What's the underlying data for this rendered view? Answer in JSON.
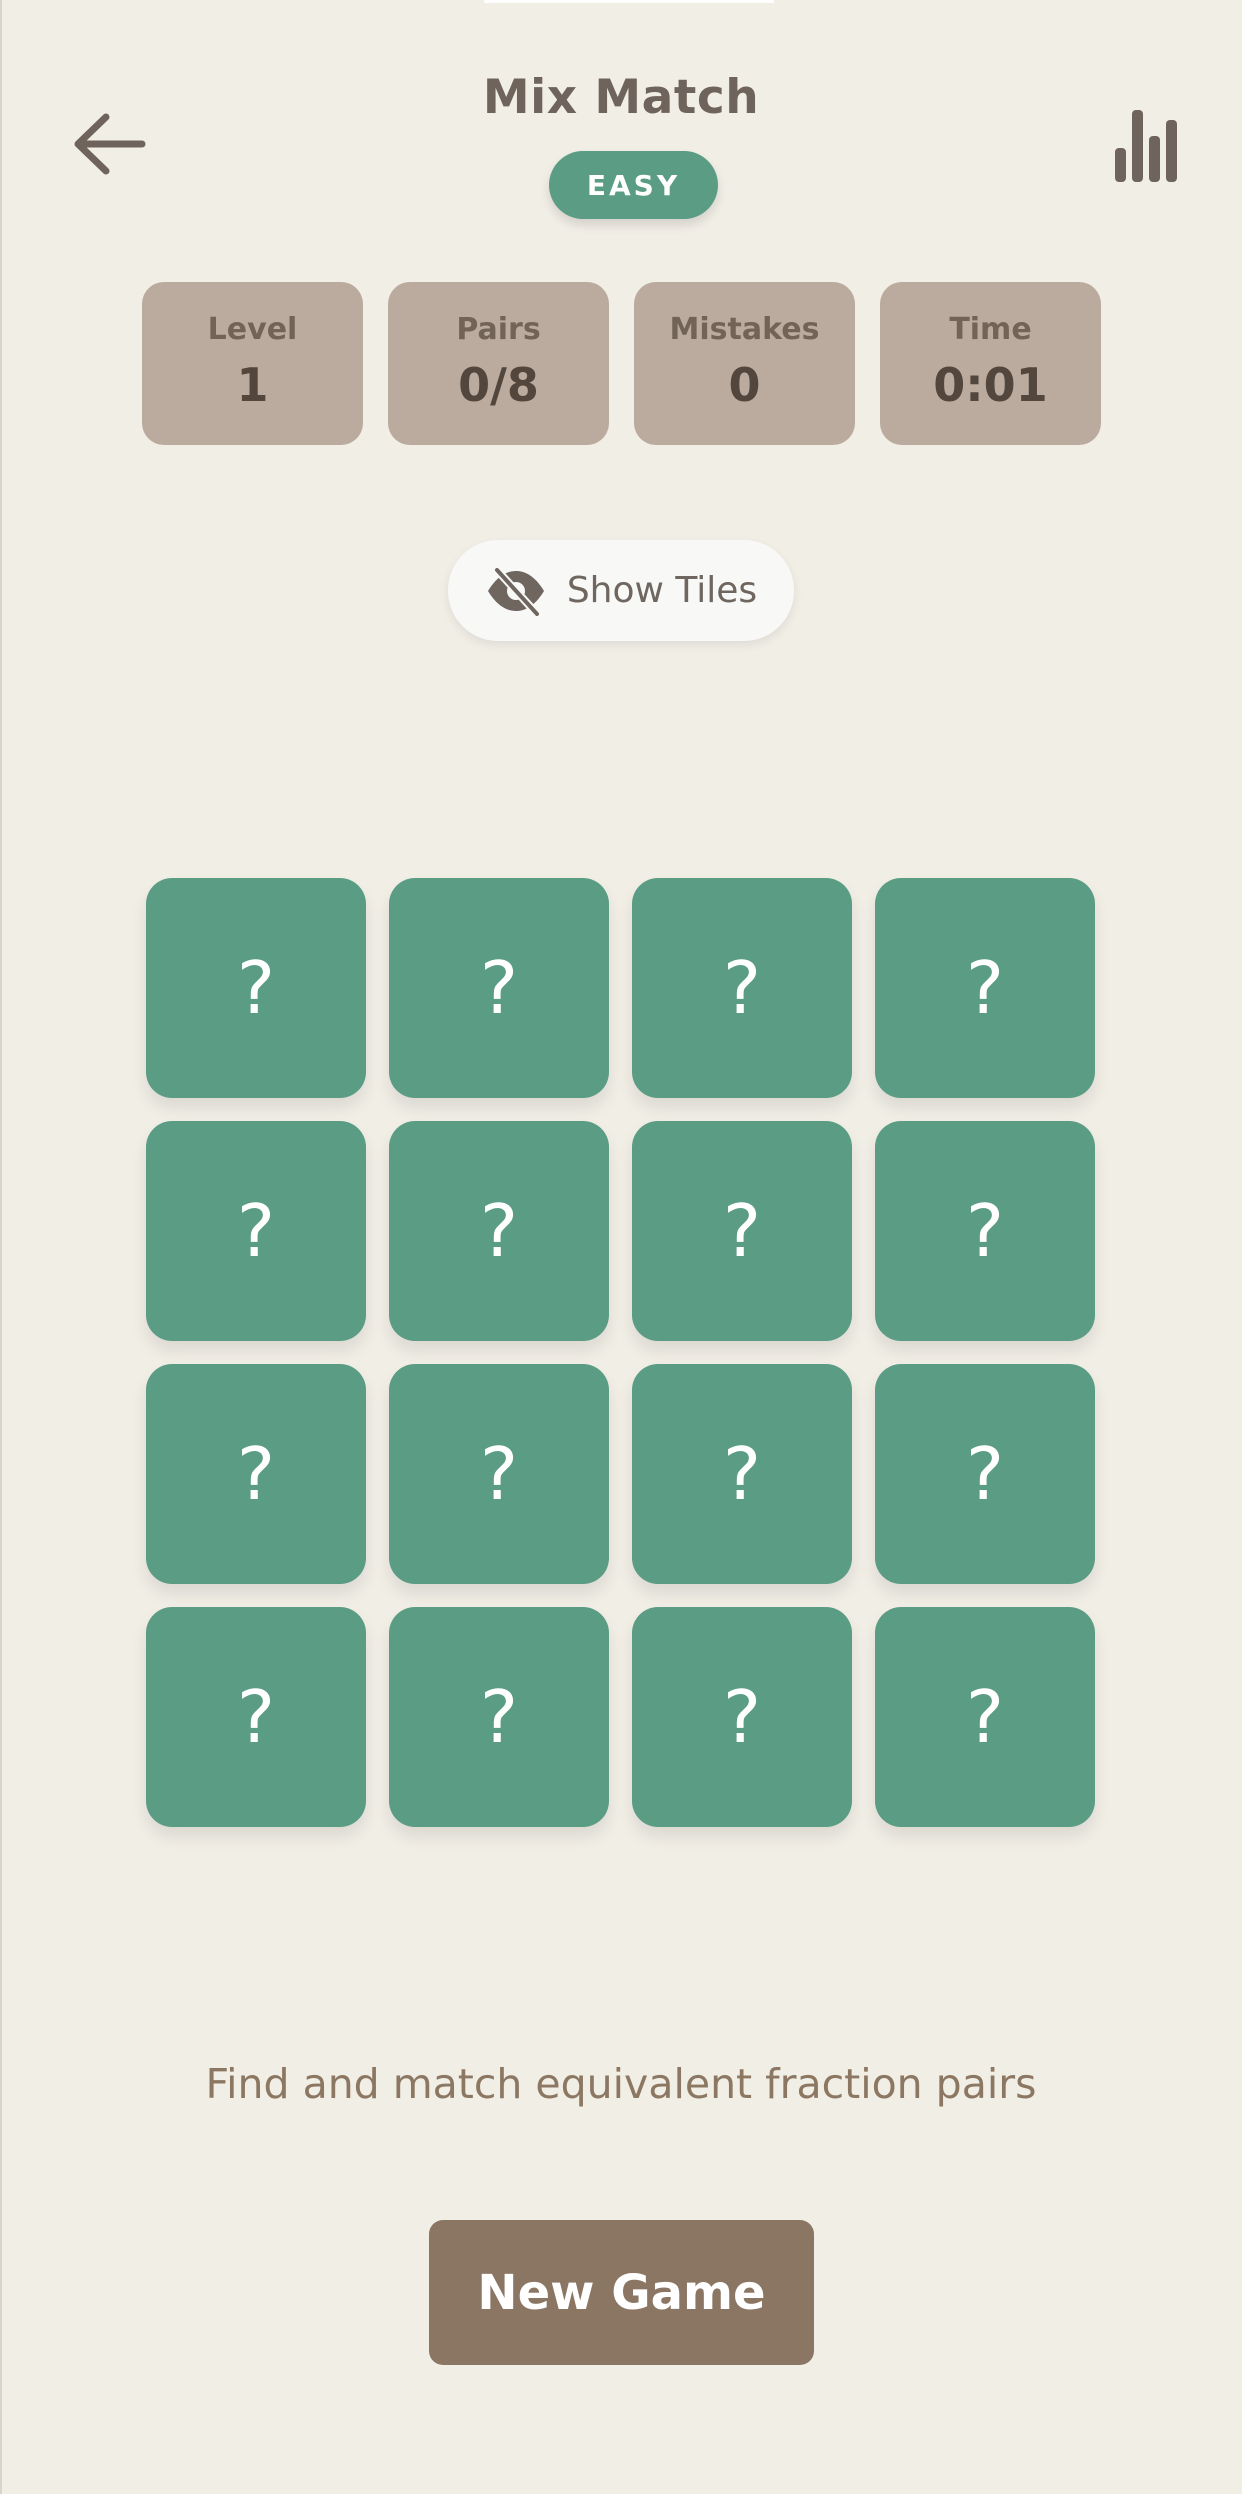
{
  "header": {
    "title": "Mix Match",
    "difficulty": "EASY",
    "back_icon": "arrow-left-icon",
    "stats_icon": "bar-chart-icon"
  },
  "stats": [
    {
      "label": "Level",
      "value": "1"
    },
    {
      "label": "Pairs",
      "value": "0/8"
    },
    {
      "label": "Mistakes",
      "value": "0"
    },
    {
      "label": "Time",
      "value": "0:01"
    }
  ],
  "show_tiles": {
    "label": "Show Tiles",
    "icon": "eye-off-icon"
  },
  "board": {
    "rows": 4,
    "cols": 4,
    "tiles": [
      "?",
      "?",
      "?",
      "?",
      "?",
      "?",
      "?",
      "?",
      "?",
      "?",
      "?",
      "?",
      "?",
      "?",
      "?",
      "?"
    ]
  },
  "hint": "Find and match equivalent fraction pairs",
  "new_game_label": "New Game",
  "colors": {
    "background": "#f1eee6",
    "accent": "#5b9c85",
    "stat_card": "#bbab9e",
    "new_game_button": "#8b7664",
    "text_primary": "#6f645c"
  }
}
